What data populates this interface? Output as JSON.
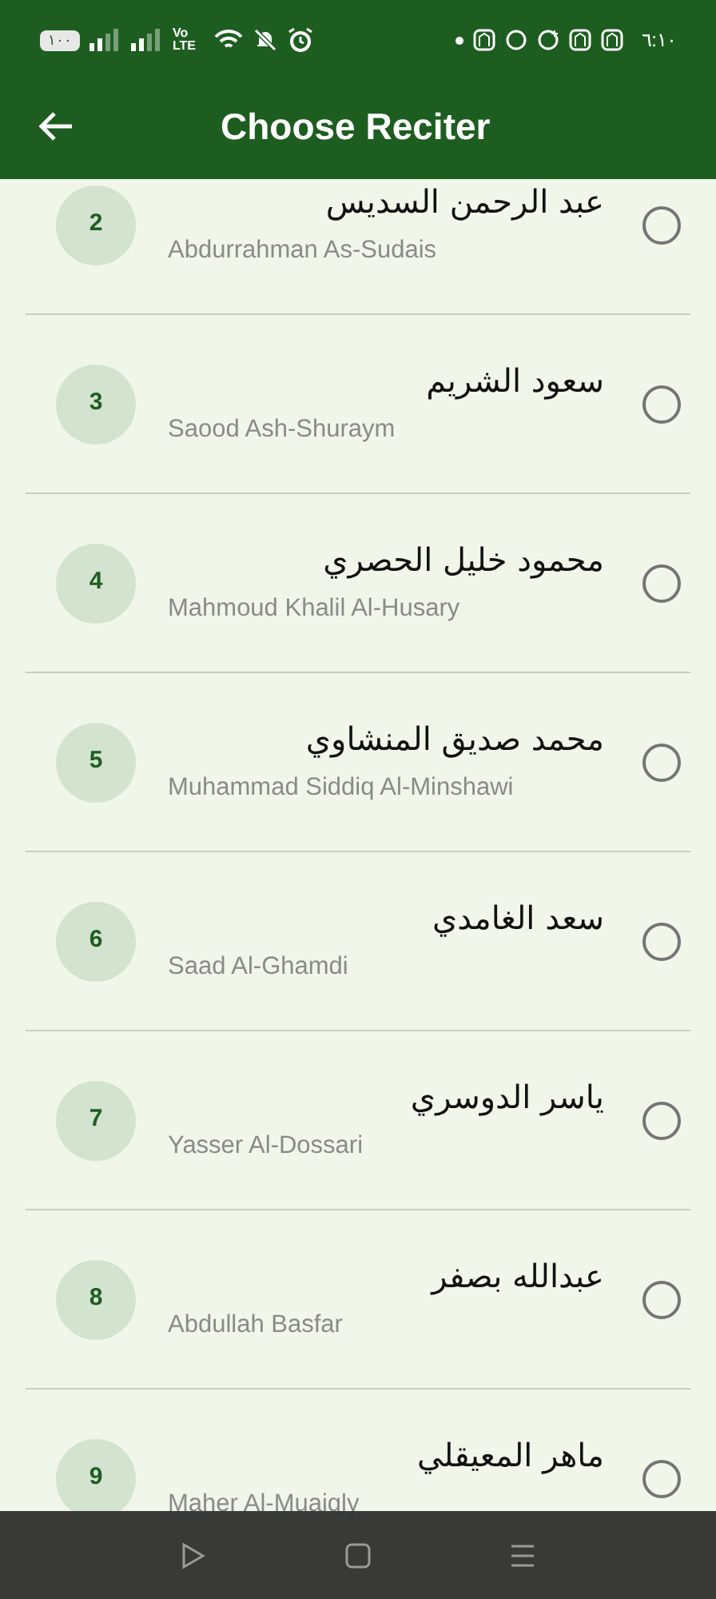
{
  "status_bar": {
    "battery": "١٠٠",
    "network": "Vo LTE",
    "time": "٦:١٠"
  },
  "app_bar": {
    "title": "Choose Reciter"
  },
  "reciters": [
    {
      "number": "2",
      "arabic_name": "عبد الرحمن السديس",
      "name": "Abdurrahman As-Sudais",
      "selected": false
    },
    {
      "number": "3",
      "arabic_name": "سعود الشريم",
      "name": "Saood Ash-Shuraym",
      "selected": false
    },
    {
      "number": "4",
      "arabic_name": "محمود خليل الحصري",
      "name": "Mahmoud Khalil Al-Husary",
      "selected": false
    },
    {
      "number": "5",
      "arabic_name": "محمد صديق المنشاوي",
      "name": "Muhammad Siddiq Al-Minshawi",
      "selected": false
    },
    {
      "number": "6",
      "arabic_name": "سعد الغامدي",
      "name": "Saad Al-Ghamdi",
      "selected": false
    },
    {
      "number": "7",
      "arabic_name": "ياسر الدوسري",
      "name": "Yasser Al-Dossari",
      "selected": false
    },
    {
      "number": "8",
      "arabic_name": "عبدالله بصفر",
      "name": "Abdullah Basfar",
      "selected": false
    },
    {
      "number": "9",
      "arabic_name": "ماهر المعيقلي",
      "name": "Maher Al-Muaiqly",
      "selected": false
    }
  ]
}
